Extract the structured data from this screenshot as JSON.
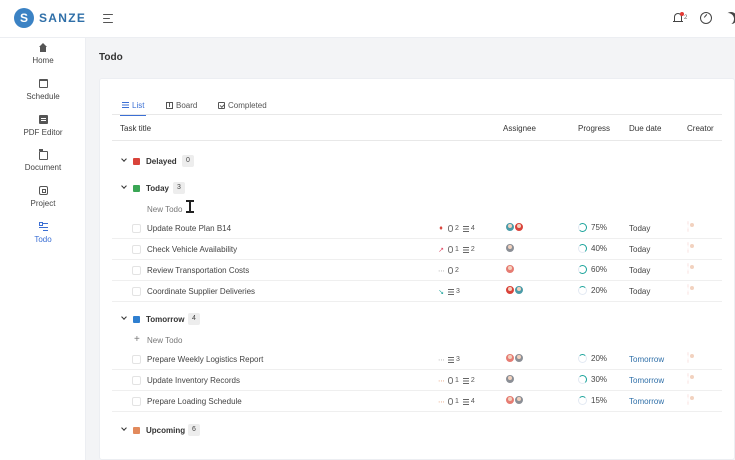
{
  "app": {
    "brand": "SANZE",
    "notification_count": "2"
  },
  "sidebar": {
    "items": [
      {
        "label": "Home",
        "icon": "home-icon"
      },
      {
        "label": "Schedule",
        "icon": "calendar-icon"
      },
      {
        "label": "PDF Editor",
        "icon": "pdf-icon"
      },
      {
        "label": "Document",
        "icon": "folder-icon"
      },
      {
        "label": "Project",
        "icon": "briefcase-icon"
      },
      {
        "label": "Todo",
        "icon": "checklist-icon",
        "active": true
      }
    ]
  },
  "page": {
    "title": "Todo"
  },
  "tabs": [
    {
      "label": "List",
      "active": true
    },
    {
      "label": "Board"
    },
    {
      "label": "Completed"
    }
  ],
  "columns": {
    "task": "Task title",
    "assignee": "Assignee",
    "progress": "Progress",
    "due": "Due date",
    "creator": "Creator"
  },
  "groups": {
    "delayed": {
      "name": "Delayed",
      "count": "0",
      "color": "#d9433a"
    },
    "today": {
      "name": "Today",
      "count": "3",
      "color": "#3aa655",
      "new_todo": "New Todo",
      "rows": [
        {
          "title": "Update Route Plan B14",
          "attachments": "2",
          "subtasks": "4",
          "progress": "75%",
          "due": "Today"
        },
        {
          "title": "Check Vehicle Availability",
          "attachments": "1",
          "subtasks": "2",
          "progress": "40%",
          "due": "Today"
        },
        {
          "title": "Review Transportation Costs",
          "attachments": "2",
          "progress": "60%",
          "due": "Today"
        },
        {
          "title": "Coordinate Supplier Deliveries",
          "subtasks": "3",
          "progress": "20%",
          "due": "Today"
        }
      ]
    },
    "tomorrow": {
      "name": "Tomorrow",
      "count": "4",
      "color": "#2f7fd0",
      "new_todo": "New Todo",
      "rows": [
        {
          "title": "Prepare Weekly Logistics Report",
          "subtasks": "3",
          "progress": "20%",
          "due": "Tomorrow"
        },
        {
          "title": "Update Inventory Records",
          "attachments": "1",
          "subtasks": "2",
          "progress": "30%",
          "due": "Tomorrow"
        },
        {
          "title": "Prepare Loading Schedule",
          "attachments": "1",
          "subtasks": "4",
          "progress": "15%",
          "due": "Tomorrow"
        }
      ]
    },
    "upcoming": {
      "name": "Upcoming",
      "count": "6",
      "color": "#e28a5c"
    }
  }
}
